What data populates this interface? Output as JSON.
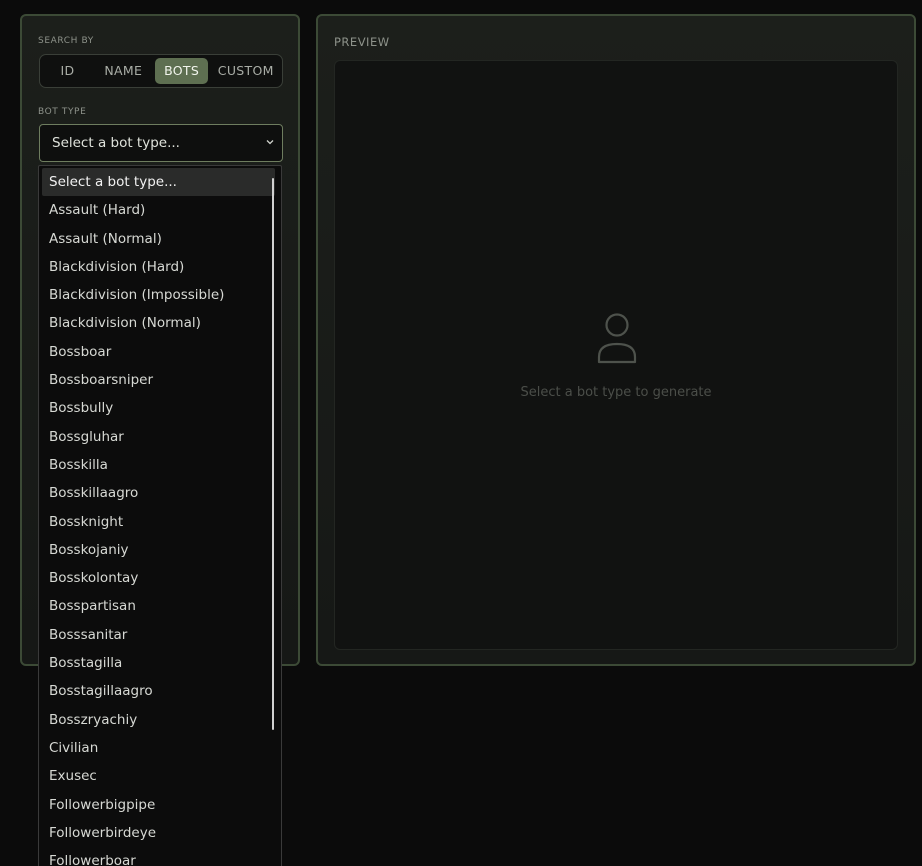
{
  "search": {
    "label": "SEARCH BY",
    "options": [
      "ID",
      "NAME",
      "BOTS",
      "CUSTOM"
    ],
    "selected": "BOTS"
  },
  "bot_type": {
    "label": "BOT TYPE",
    "value": "Select a bot type...",
    "options": [
      "Select a bot type...",
      "Assault (Hard)",
      "Assault (Normal)",
      "Blackdivision (Hard)",
      "Blackdivision (Impossible)",
      "Blackdivision (Normal)",
      "Bossboar",
      "Bossboarsniper",
      "Bossbully",
      "Bossgluhar",
      "Bosskilla",
      "Bosskillaagro",
      "Bossknight",
      "Bosskojaniy",
      "Bosskolontay",
      "Bosspartisan",
      "Bosssanitar",
      "Bosstagilla",
      "Bosstagillaagro",
      "Bosszryachiy",
      "Civilian",
      "Exusec",
      "Followerbigpipe",
      "Followerbirdeye",
      "Followerboar"
    ]
  },
  "preview": {
    "label": "PREVIEW",
    "hint": "Select a bot type to generate",
    "icon": "person-outline-icon"
  },
  "colors": {
    "accent": "#5e6f51",
    "border": "#3c4a36",
    "background": "#0b0b0b"
  }
}
